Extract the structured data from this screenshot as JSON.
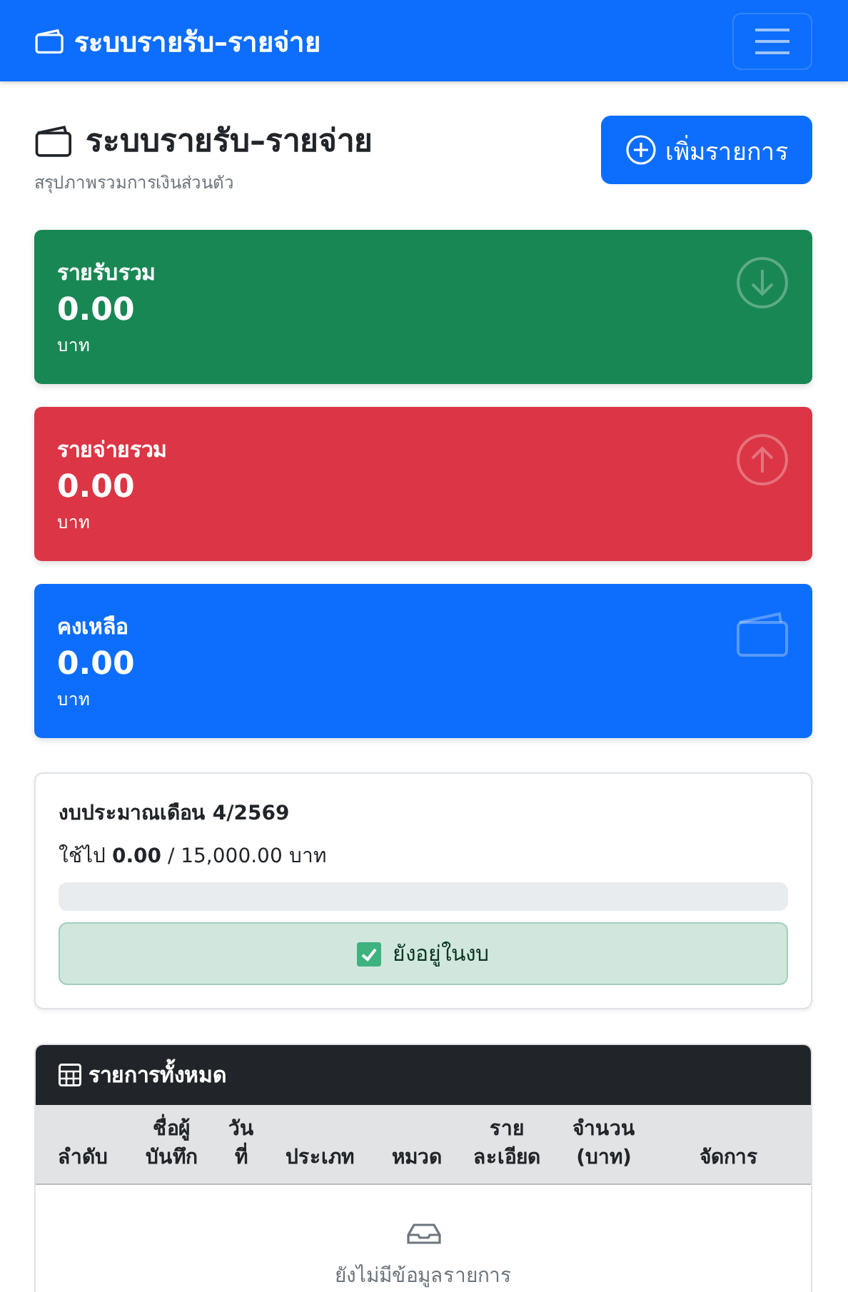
{
  "navbar": {
    "brand": "ระบบรายรับ–รายจ่าย"
  },
  "header": {
    "title": "ระบบรายรับ–รายจ่าย",
    "subtitle": "สรุปภาพรวมการเงินส่วนตัว",
    "add_button": "เพิ่มรายการ"
  },
  "stats": [
    {
      "kind": "income",
      "label": "รายรับรวม",
      "value": "0.00",
      "unit": "บาท"
    },
    {
      "kind": "expense",
      "label": "รายจ่ายรวม",
      "value": "0.00",
      "unit": "บาท"
    },
    {
      "kind": "balance",
      "label": "คงเหลือ",
      "value": "0.00",
      "unit": "บาท"
    }
  ],
  "budget": {
    "title": "งบประมาณเดือน 4/2569",
    "usage": "ใช้ไป **0.00** / 15,000.00 บาท",
    "level": 0,
    "status": {
      "kind": "ok",
      "text": "ยังอยู่ในงบ"
    }
  },
  "table": {
    "title": "รายการทั้งหมด",
    "columns": [
      "ลำดับ",
      "ชื่อผู้บันทึก",
      "วันที่",
      "ประเภท",
      "หมวด",
      "รายละเอียด",
      "จำนวน (บาท)",
      "จัดการ"
    ],
    "empty_text": "ยังไม่มีข้อมูลรายการ"
  }
}
